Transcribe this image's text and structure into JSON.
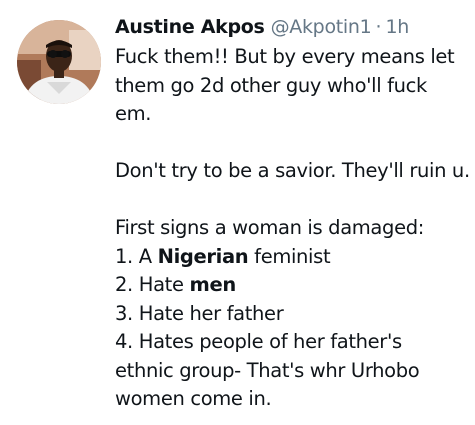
{
  "tweet": {
    "display_name": "Austine Akpos",
    "handle": "@Akpotin1",
    "separator": "·",
    "time": "1h",
    "paragraph1": {
      "line1": "Fuck them!! But by every means let",
      "line2": "them go 2d other guy who'll fuck",
      "line3": "em."
    },
    "paragraph2": {
      "line1": "Don't try to be a savior. They'll ruin u."
    },
    "paragraph3": {
      "line1": "First signs a woman is damaged:",
      "item1_prefix": "1. A ",
      "item1_bold": "Nigerian",
      "item1_suffix": " feminist",
      "item2_prefix": "2. Hate ",
      "item2_bold": "men",
      "item3": "3. Hate her father",
      "item4_line1": "4. Hates people of her father's",
      "item4_line2": "ethnic group- That's whr Urhobo",
      "item4_line3": "women come in."
    }
  },
  "colors": {
    "text": "#0f1419",
    "secondary": "#657786",
    "background": "#ffffff"
  },
  "icons": {
    "avatar": "profile-photo"
  }
}
